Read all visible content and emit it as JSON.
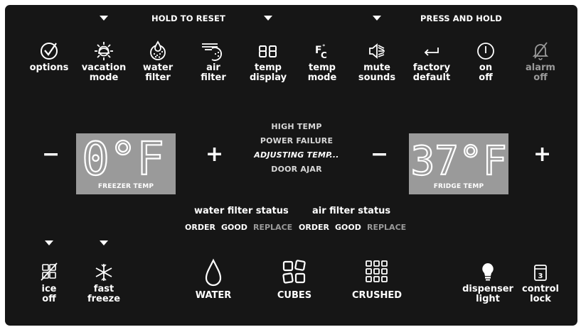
{
  "top_headers": {
    "hold_to_reset": "HOLD TO RESET",
    "press_and_hold": "PRESS AND HOLD"
  },
  "top_buttons": [
    {
      "label": "options",
      "icon": "checkmark-circle-icon"
    },
    {
      "label": "vacation\nmode",
      "icon": "sun-icon"
    },
    {
      "label": "water\nfilter",
      "icon": "water-filter-icon"
    },
    {
      "label": "air\nfilter",
      "icon": "air-filter-icon"
    },
    {
      "label": "temp\ndisplay",
      "icon": "digits-88-icon"
    },
    {
      "label": "temp\nmode",
      "icon": "fahrenheit-celsius-icon"
    },
    {
      "label": "mute\nsounds",
      "icon": "mute-speaker-icon"
    },
    {
      "label": "factory\ndefault",
      "icon": "return-arrow-icon"
    },
    {
      "label": "on\noff",
      "icon": "power-icon"
    },
    {
      "label": "alarm\noff",
      "icon": "bell-off-icon"
    }
  ],
  "freezer": {
    "value": "0°F",
    "caption": "FREEZER TEMP",
    "minus": "−",
    "plus": "+"
  },
  "fridge": {
    "value": "37°F",
    "caption": "FRIDGE TEMP",
    "minus": "−",
    "plus": "+"
  },
  "alerts": [
    "HIGH TEMP",
    "POWER FAILURE",
    "ADJUSTING TEMP...",
    "DOOR AJAR"
  ],
  "water_filter_status": {
    "title": "water filter status",
    "options": [
      "ORDER",
      "GOOD",
      "REPLACE"
    ]
  },
  "air_filter_status": {
    "title": "air filter status",
    "options": [
      "ORDER",
      "GOOD",
      "REPLACE"
    ]
  },
  "bottom_left": [
    {
      "label": "ice\noff",
      "icon": "ice-off-icon"
    },
    {
      "label": "fast\nfreeze",
      "icon": "snowflake-icon"
    }
  ],
  "dispense": [
    {
      "label": "WATER",
      "icon": "water-drop-icon"
    },
    {
      "label": "CUBES",
      "icon": "ice-cubes-icon"
    },
    {
      "label": "CRUSHED",
      "icon": "crushed-ice-icon"
    }
  ],
  "bottom_right": [
    {
      "label": "dispenser\nlight",
      "icon": "light-bulb-icon"
    },
    {
      "label": "control\nlock",
      "icon": "lock-3-icon"
    }
  ],
  "colors": {
    "panel": "#161616",
    "lcd": "#9a9a9a",
    "text": "#ffffff",
    "dim": "#9a9a9a"
  }
}
